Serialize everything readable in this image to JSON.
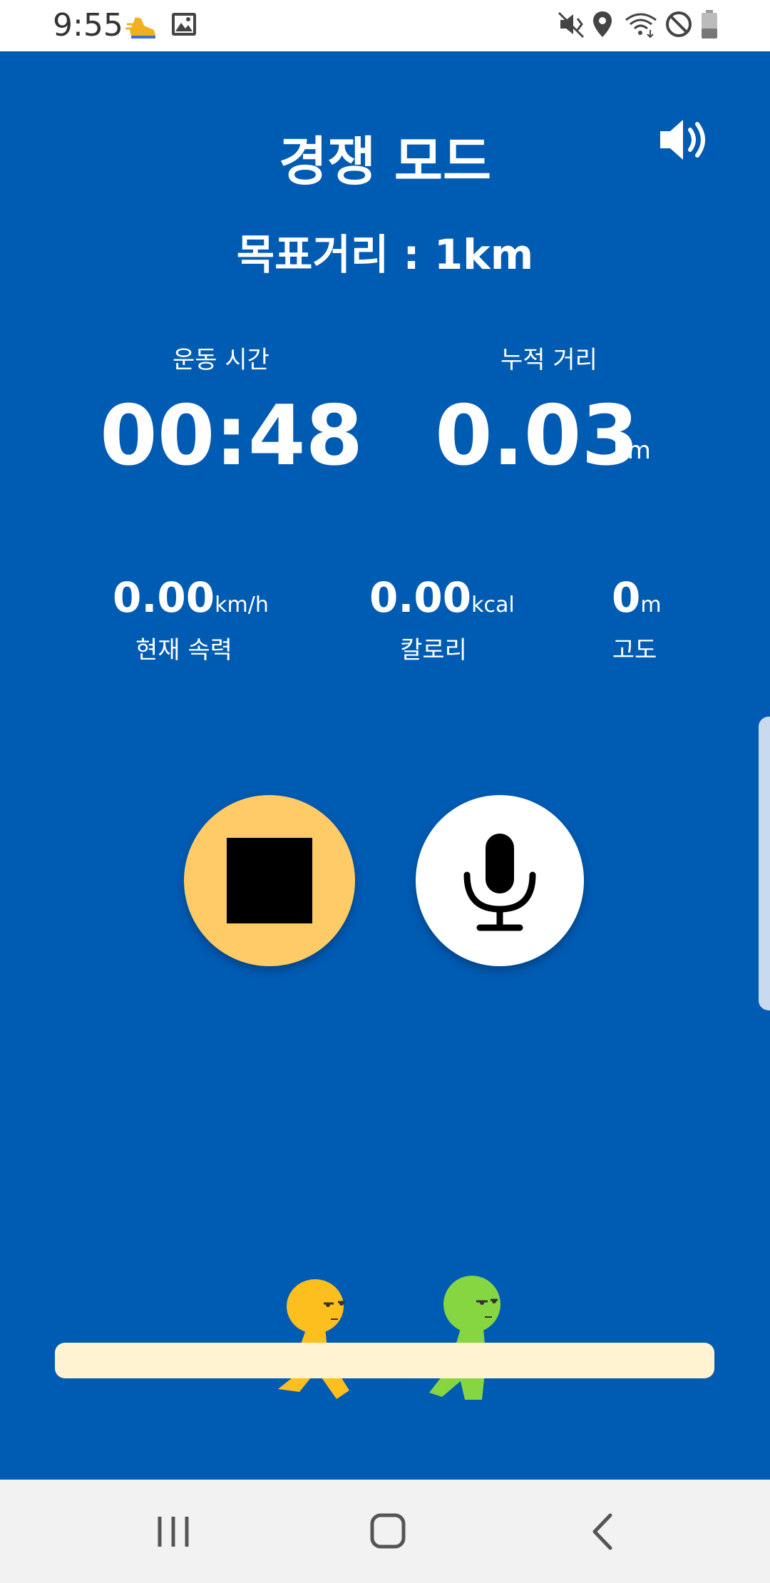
{
  "status_bar": {
    "time": "9:55"
  },
  "header": {
    "title": "경쟁 모드",
    "goal": "목표거리 : 1km"
  },
  "stats": {
    "workout_time": {
      "label": "운동 시간",
      "value": "00:48"
    },
    "distance": {
      "label": "누적 거리",
      "value": "0.03",
      "unit": "km"
    }
  },
  "metrics": {
    "speed": {
      "value": "0.00",
      "unit": "km/h",
      "label": "현재 속력"
    },
    "calories": {
      "value": "0.00",
      "unit": "kcal",
      "label": "칼로리"
    },
    "altitude": {
      "value": "0",
      "unit": "m",
      "label": "고도"
    }
  },
  "colors": {
    "background": "#005BB3",
    "stop_button": "#FFCB66",
    "track": "#FFF3D1",
    "runner_1": "#FDBF1E",
    "runner_2": "#86D642"
  },
  "icons": {
    "sound": "speaker-volume-icon",
    "stop": "stop-icon",
    "mic": "microphone-icon"
  }
}
